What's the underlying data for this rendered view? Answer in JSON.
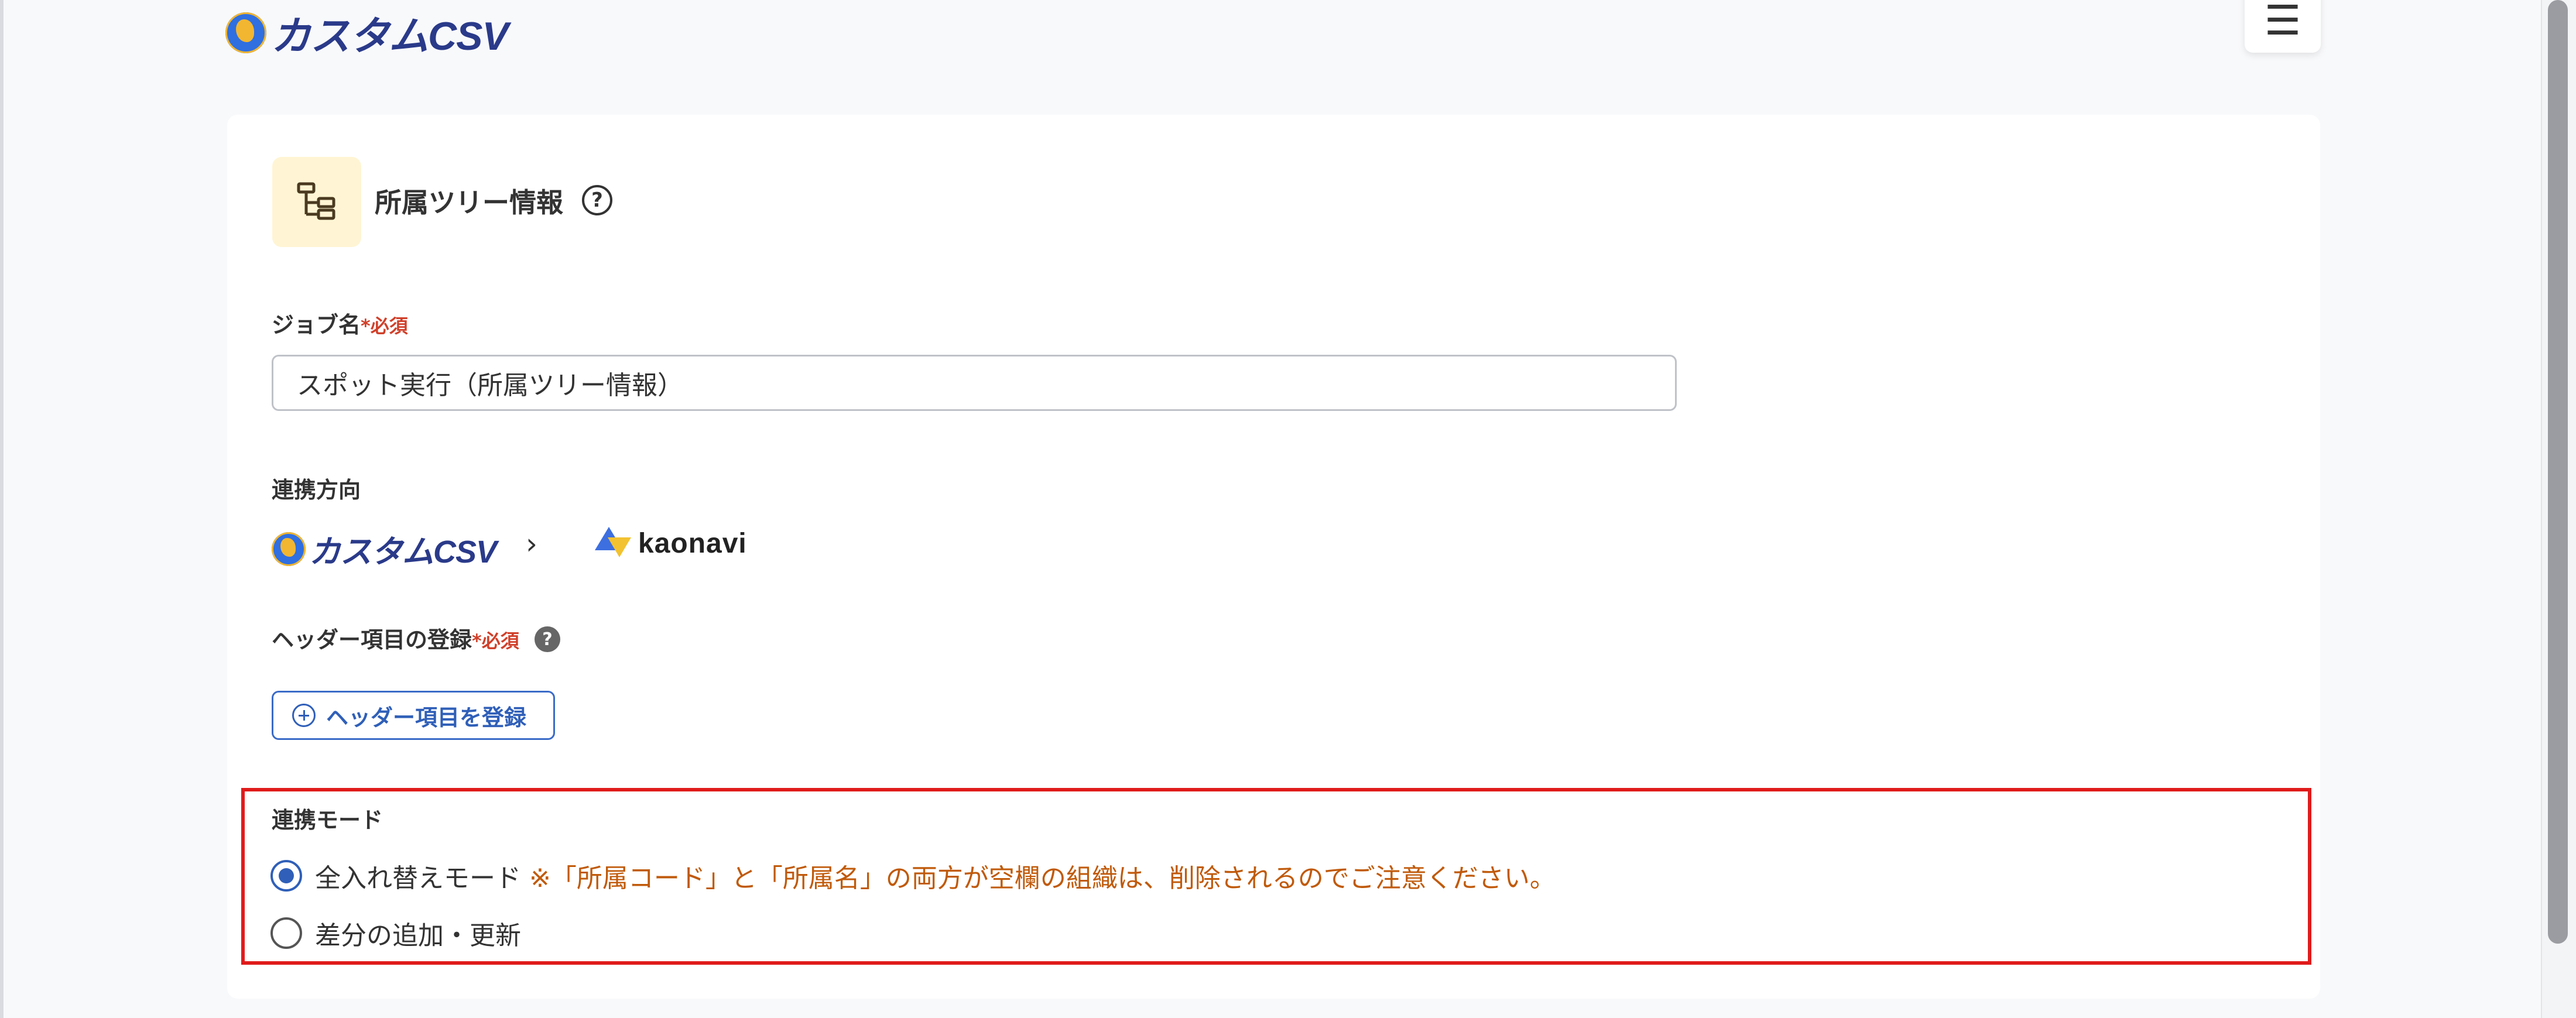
{
  "header": {
    "logo_text": "カスタムCSV",
    "menu_glyph": "☰"
  },
  "page": {
    "title": "所属ツリー情報",
    "help_glyph": "?"
  },
  "job_name": {
    "label": "ジョブ名",
    "required": "*必須",
    "value": "スポット実行（所属ツリー情報）"
  },
  "direction": {
    "label": "連携方向",
    "source": "カスタムCSV",
    "arrow": "›",
    "target": "kaonavi"
  },
  "header_items": {
    "label": "ヘッダー項目の登録",
    "required": "*必須",
    "help_glyph": "?",
    "button_label": "ヘッダー項目を登録"
  },
  "mode": {
    "label": "連携モード",
    "options": [
      {
        "label": "全入れ替えモード",
        "note": "※「所属コード」と「所属名」の両方が空欄の組織は、削除されるのでご注意ください。",
        "selected": true
      },
      {
        "label": "差分の追加・更新",
        "selected": false
      }
    ]
  },
  "colors": {
    "accent": "#2f5fb8",
    "required": "#d0402a",
    "warning": "#c05a0a",
    "highlight": "#e01b1b",
    "icon_bg": "#fff5d4"
  }
}
